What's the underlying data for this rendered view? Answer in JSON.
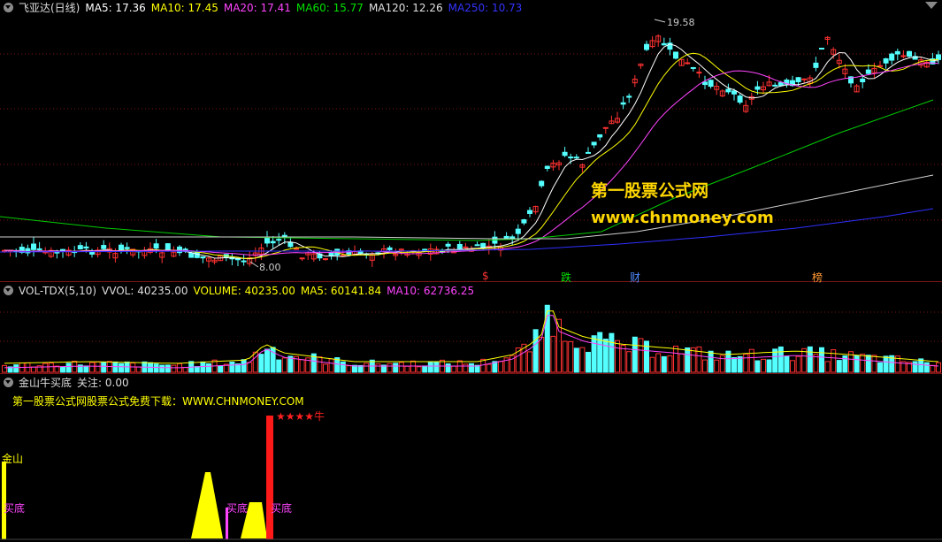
{
  "kline": {
    "title": "飞亚达(日线)",
    "ma_labels": [
      {
        "text": "MA5: 17.36",
        "color": "#ffffff"
      },
      {
        "text": "MA10: 17.45",
        "color": "#ffff00"
      },
      {
        "text": "MA20: 17.41",
        "color": "#ff44ff"
      },
      {
        "text": "MA60: 15.77",
        "color": "#00e000"
      },
      {
        "text": "MA120: 12.26",
        "color": "#e0e0e0"
      },
      {
        "text": "MA250: 10.73",
        "color": "#3333ff"
      }
    ],
    "high_label": "19.58",
    "low_label": "8.00",
    "event_tags": [
      {
        "text": "$",
        "color": "#ff3333"
      },
      {
        "text": "跌",
        "color": "#00e000"
      },
      {
        "text": "财",
        "color": "#4f8bff"
      },
      {
        "text": "榜",
        "color": "#ff9933"
      }
    ],
    "watermark_cn": "第一股票公式网",
    "watermark_url": "www.chnmoney.com"
  },
  "volume": {
    "title": "VOL-TDX(5,10)",
    "vvol": "VVOL: 40235.00",
    "volume": "VOLUME: 40235.00",
    "ma5": "MA5: 60141.84",
    "ma10": "MA10: 62736.25"
  },
  "indicator": {
    "title": "金山牛买底",
    "focus": "关注: 0.00",
    "promo": "第一股票公式网股票公式免费下载：WWW.CHNMONEY.COM",
    "label_jinshan": "金山",
    "label_buy": "买底",
    "label_star": "★★★★牛"
  },
  "colors": {
    "up": "#ff3232",
    "down": "#54ffff",
    "grid": "#7a1414"
  },
  "chart_data": {
    "type": "candlestick",
    "title": "飞亚达(日线)",
    "y_high": 19.58,
    "y_low": 8.0
  }
}
